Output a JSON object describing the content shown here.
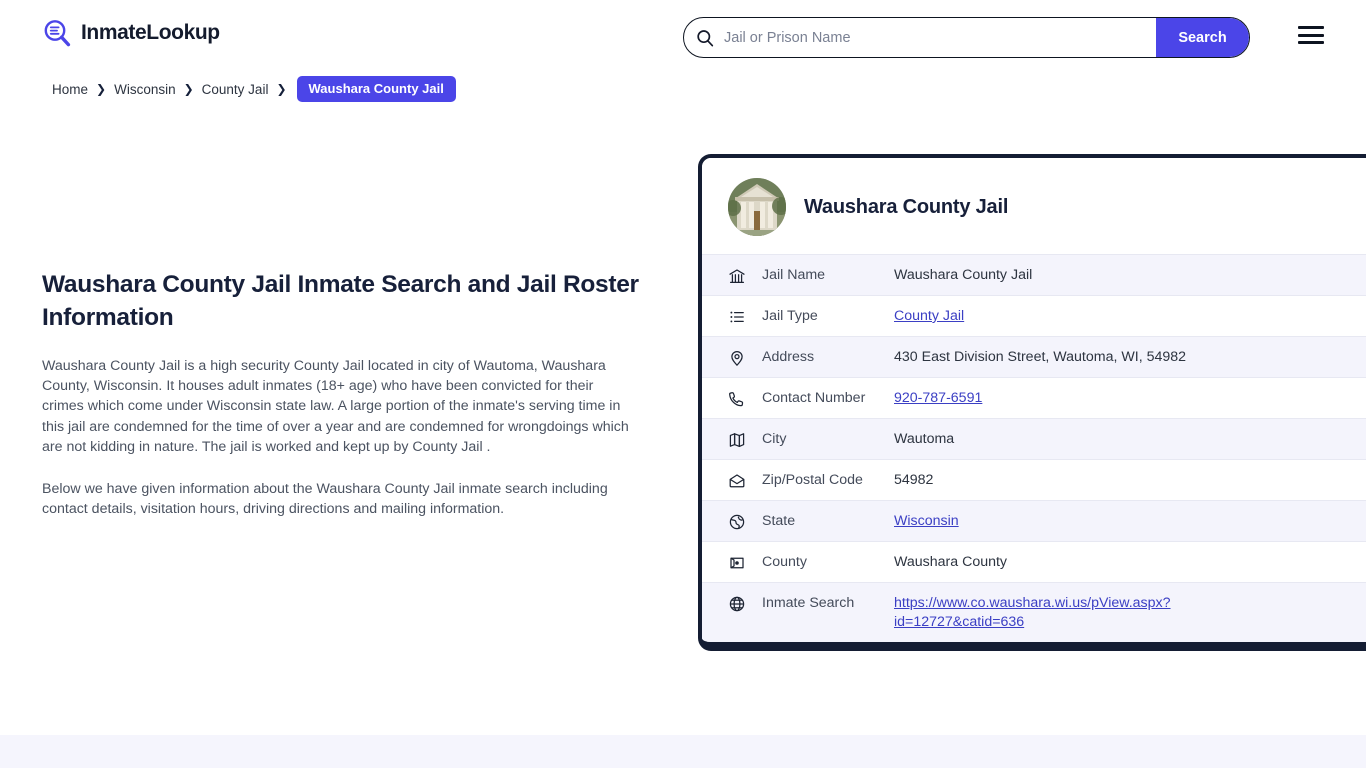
{
  "header": {
    "brand_name": "InmateLookup",
    "logo_icon": "magnifier-list-icon",
    "search": {
      "placeholder": "Jail or Prison Name",
      "value": "",
      "button_label": "Search",
      "icon": "search-icon"
    },
    "menu_icon": "hamburger-menu-icon",
    "accent_color": "#4b45e8"
  },
  "breadcrumb": {
    "items": [
      {
        "label": "Home",
        "current": false
      },
      {
        "label": "Wisconsin",
        "current": false
      },
      {
        "label": "County Jail",
        "current": false
      },
      {
        "label": "Waushara County Jail",
        "current": true
      }
    ],
    "separator": "❯"
  },
  "main": {
    "page_title": "Waushara County Jail Inmate Search and Jail Roster Information",
    "paragraphs": [
      "Waushara County Jail is a high security County Jail located in city of Wautoma, Waushara County, Wisconsin. It houses adult inmates (18+ age) who have been convicted for their crimes which come under Wisconsin state law. A large portion of the inmate's serving time in this jail are condemned for the time of over a year and are condemned for wrongdoings which are not kidding in nature. The jail is worked and kept up by County Jail .",
      "Below we have given information about the Waushara County Jail inmate search including contact details, visitation hours, driving directions and mailing information."
    ]
  },
  "info_card": {
    "title": "Waushara County Jail",
    "thumbnail_icon": "courthouse-photo",
    "border_color": "#141d33",
    "stripe_color": "#f4f4fc",
    "rows": [
      {
        "icon": "bank-icon",
        "label": "Jail Name",
        "value": "Waushara County Jail",
        "link": false
      },
      {
        "icon": "list-icon",
        "label": "Jail Type",
        "value": "County Jail",
        "link": true
      },
      {
        "icon": "map-pin-icon",
        "label": "Address",
        "value": "430 East Division Street, Wautoma, WI, 54982",
        "link": false
      },
      {
        "icon": "phone-icon",
        "label": "Contact Number",
        "value": "920-787-6591",
        "link": true
      },
      {
        "icon": "map-icon",
        "label": "City",
        "value": "Wautoma",
        "link": false
      },
      {
        "icon": "envelope-icon",
        "label": "Zip/Postal Code",
        "value": "54982",
        "link": false
      },
      {
        "icon": "globe-state-icon",
        "label": "State",
        "value": "Wisconsin",
        "link": true
      },
      {
        "icon": "county-map-icon",
        "label": "County",
        "value": "Waushara County",
        "link": false
      },
      {
        "icon": "globe-icon",
        "label": "Inmate Search",
        "value": "https://www.co.waushara.wi.us/pView.aspx?id=12727&catid=636",
        "link": true
      }
    ]
  }
}
